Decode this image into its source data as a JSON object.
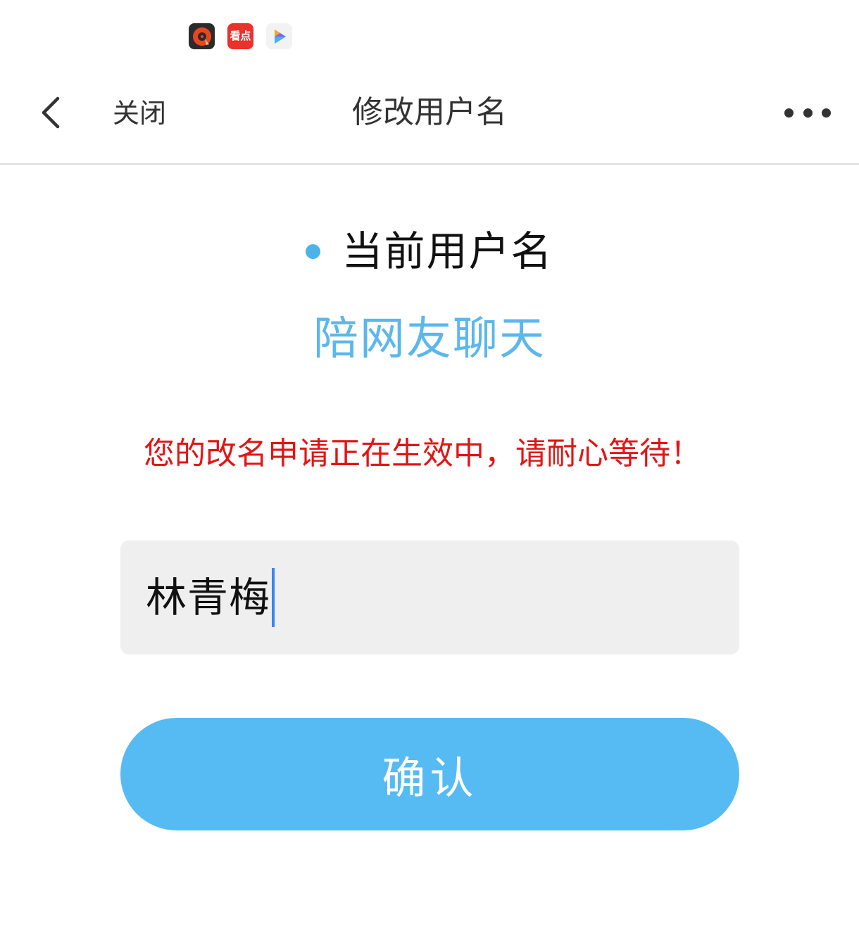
{
  "status_bar": {
    "icons": [
      "music-player-icon",
      "kandian-app-icon",
      "video-player-icon"
    ],
    "kandian_label": "看点"
  },
  "nav": {
    "close_label": "关闭",
    "title": "修改用户名",
    "back_icon": "chevron-left-icon",
    "more_icon": "more-dots-icon"
  },
  "content": {
    "heading": "当前用户名",
    "current_username": "陪网友聊天",
    "notice": "您的改名申请正在生效中，请耐心等待！",
    "input_value": "林青梅",
    "confirm_label": "确认"
  },
  "colors": {
    "accent": "#55bbf2",
    "username_text": "#5bb7ec",
    "notice_text": "#e21515",
    "input_bg": "#efefef"
  }
}
